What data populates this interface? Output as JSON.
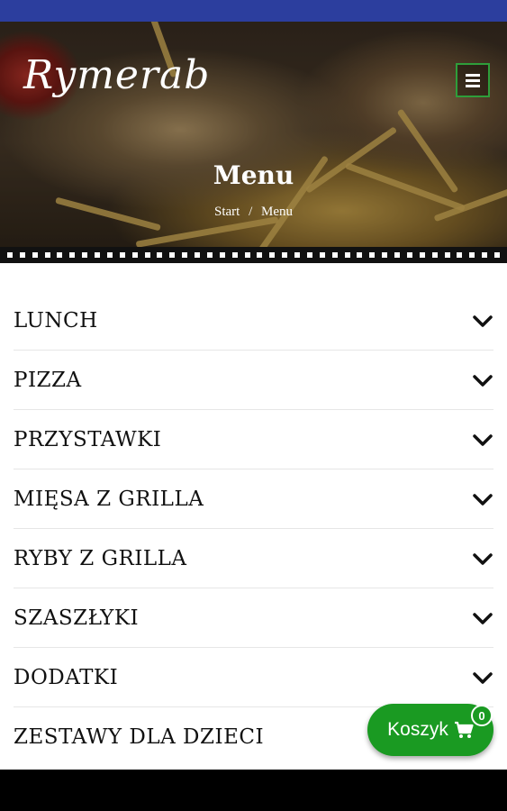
{
  "header": {
    "logo_text": "Rymerab",
    "menu_icon": "hamburger-menu-icon",
    "title": "Menu",
    "breadcrumb": {
      "home": "Start",
      "separator": "/",
      "current": "Menu"
    }
  },
  "menu": {
    "categories": [
      {
        "label": "LUNCH"
      },
      {
        "label": "PIZZA"
      },
      {
        "label": "PRZYSTAWKI"
      },
      {
        "label": "MIĘSA Z GRILLA"
      },
      {
        "label": "RYBY Z GRILLA"
      },
      {
        "label": "SZASZŁYKI"
      },
      {
        "label": "DODATKI"
      },
      {
        "label": "ZESTAWY DLA DZIECI"
      }
    ],
    "expand_icon": "chevron-down-icon"
  },
  "cart": {
    "label": "Koszyk",
    "icon": "shopping-cart-icon",
    "count": "0"
  },
  "colors": {
    "status_bar": "#2c3e9e",
    "accent_green": "#1a9a22",
    "menu_button_border": "#2e9e3a"
  }
}
